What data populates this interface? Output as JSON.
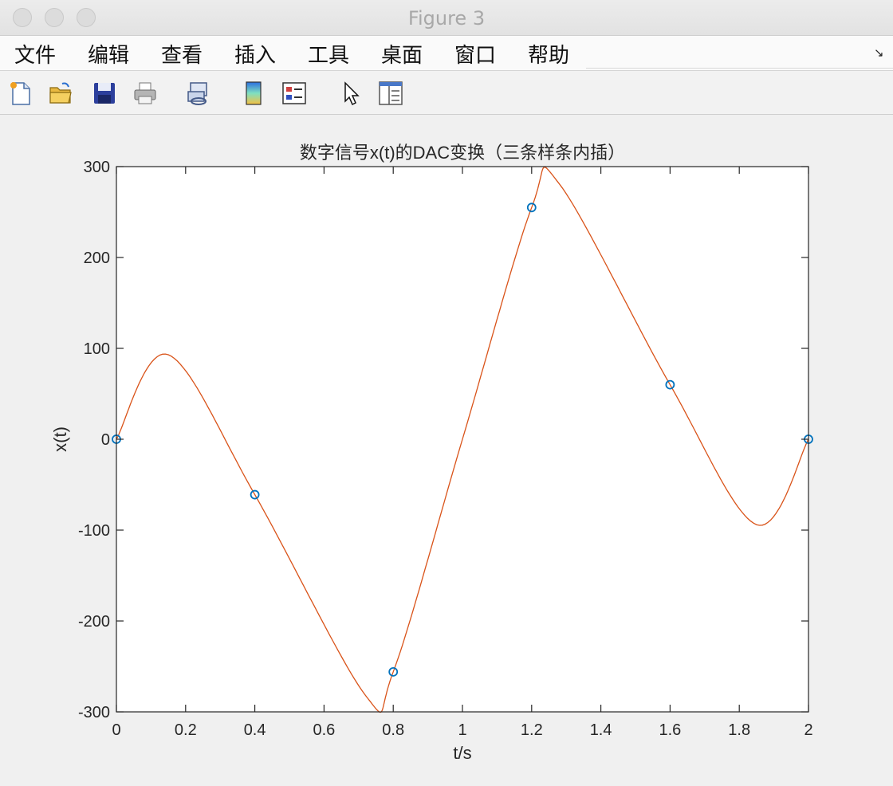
{
  "window": {
    "title": "Figure 3"
  },
  "menu": {
    "items": [
      "文件",
      "编辑",
      "查看",
      "插入",
      "工具",
      "桌面",
      "窗口",
      "帮助"
    ]
  },
  "toolbar": {
    "icons": [
      "new-figure-icon",
      "open-file-icon",
      "save-icon",
      "print-icon",
      "link-icon",
      "colorbar-icon",
      "legend-icon",
      "pointer-icon",
      "property-editor-icon"
    ]
  },
  "chart_data": {
    "type": "line",
    "title": "数字信号x(t)的DAC变换（三条样条内插）",
    "xlabel": "t/s",
    "ylabel": "x(t)",
    "xlim": [
      0,
      2
    ],
    "ylim": [
      -300,
      300
    ],
    "x_ticks": [
      "0",
      "0.2",
      "0.4",
      "0.6",
      "0.8",
      "1",
      "1.2",
      "1.4",
      "1.6",
      "1.8",
      "2"
    ],
    "y_ticks": [
      "300",
      "200",
      "100",
      "0",
      "-100",
      "-200",
      "-300"
    ],
    "grid": false,
    "series": [
      {
        "type": "scatter",
        "marker": "circle",
        "color": "#0072bd",
        "x": [
          0,
          0.4,
          0.8,
          1.2,
          1.6,
          2.0
        ],
        "y": [
          0,
          -61,
          -256,
          255,
          60,
          0
        ]
      },
      {
        "type": "line",
        "color": "#d95319",
        "x": [
          0,
          0.15,
          0.4,
          0.72,
          0.8,
          1.0,
          1.2,
          1.28,
          1.6,
          1.85,
          2.0
        ],
        "y": [
          0,
          93,
          -61,
          -282,
          -256,
          0,
          255,
          281,
          60,
          -94,
          0
        ]
      }
    ]
  }
}
